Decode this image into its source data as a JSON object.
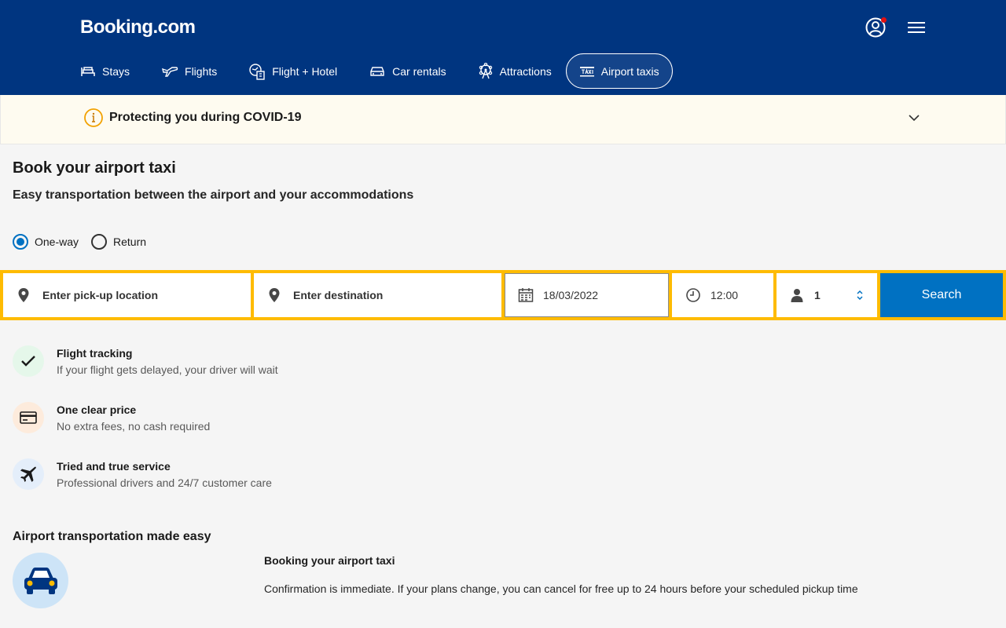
{
  "header": {
    "logo": "Booking.com",
    "nav": [
      {
        "label": "Stays",
        "icon": "bed-icon"
      },
      {
        "label": "Flights",
        "icon": "plane-icon"
      },
      {
        "label": "Flight + Hotel",
        "icon": "flight-hotel-icon"
      },
      {
        "label": "Car rentals",
        "icon": "car-icon"
      },
      {
        "label": "Attractions",
        "icon": "ferris-wheel-icon"
      },
      {
        "label": "Airport taxis",
        "icon": "taxi-icon",
        "active": true
      }
    ]
  },
  "banner": {
    "text": "Protecting you during COVID-19"
  },
  "page": {
    "title": "Book your airport taxi",
    "subtitle": "Easy transportation between the airport and your accommodations"
  },
  "trip_type": {
    "one_way": "One-way",
    "return": "Return",
    "selected": "One-way"
  },
  "search": {
    "pickup_placeholder": "Enter pick-up location",
    "destination_placeholder": "Enter destination",
    "date": "18/03/2022",
    "time": "12:00",
    "passengers": "1",
    "button": "Search"
  },
  "features": [
    {
      "title": "Flight tracking",
      "desc": "If your flight gets delayed, your driver will wait",
      "icon": "check-icon"
    },
    {
      "title": "One clear price",
      "desc": "No extra fees, no cash required",
      "icon": "credit-card-icon"
    },
    {
      "title": "Tried and true service",
      "desc": "Professional drivers and 24/7 customer care",
      "icon": "airplane-icon"
    }
  ],
  "section": {
    "title": "Airport transportation made easy",
    "info_title": "Booking your airport taxi",
    "info_text": "Confirmation is immediate. If your plans change, you can cancel for free up to 24 hours before your scheduled pickup time"
  },
  "colors": {
    "brand": "#003580",
    "accent": "#0071c2",
    "search_border": "#febb02"
  }
}
